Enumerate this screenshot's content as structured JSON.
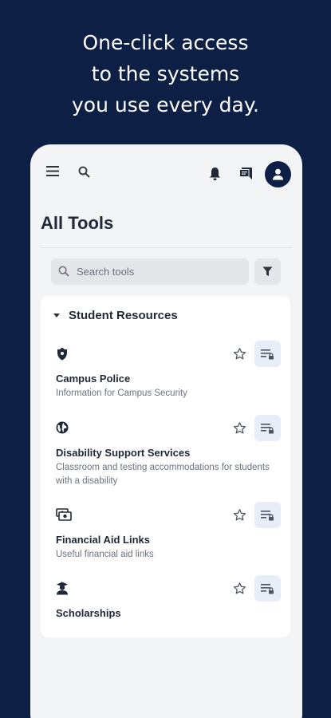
{
  "headline": {
    "line1": "One-click access",
    "line2": "to the systems",
    "line3": "you use every day."
  },
  "colors": {
    "brand_navy": "#0d1f45",
    "screen_bg": "#f3f4f6",
    "action_bg": "#e8eef8"
  },
  "appbar": {
    "icons": [
      "menu-icon",
      "search-icon",
      "bell-icon",
      "chat-icon",
      "account-icon"
    ]
  },
  "page": {
    "title": "All Tools"
  },
  "search": {
    "placeholder": "Search tools",
    "value": ""
  },
  "section": {
    "label": "Student Resources",
    "expanded": true,
    "items": [
      {
        "name": "Campus Police",
        "description": "Information for Campus Security",
        "icon": "police-badge-icon",
        "favorited": false
      },
      {
        "name": "Disability Support Services",
        "description": "Classroom and testing accommodations for students with a disability",
        "icon": "globe-icon",
        "favorited": false
      },
      {
        "name": "Financial Aid Links",
        "description": "Useful financial aid links",
        "icon": "money-icon",
        "favorited": false
      },
      {
        "name": "Scholarships",
        "description": "",
        "icon": "scholar-icon",
        "favorited": false
      }
    ]
  }
}
